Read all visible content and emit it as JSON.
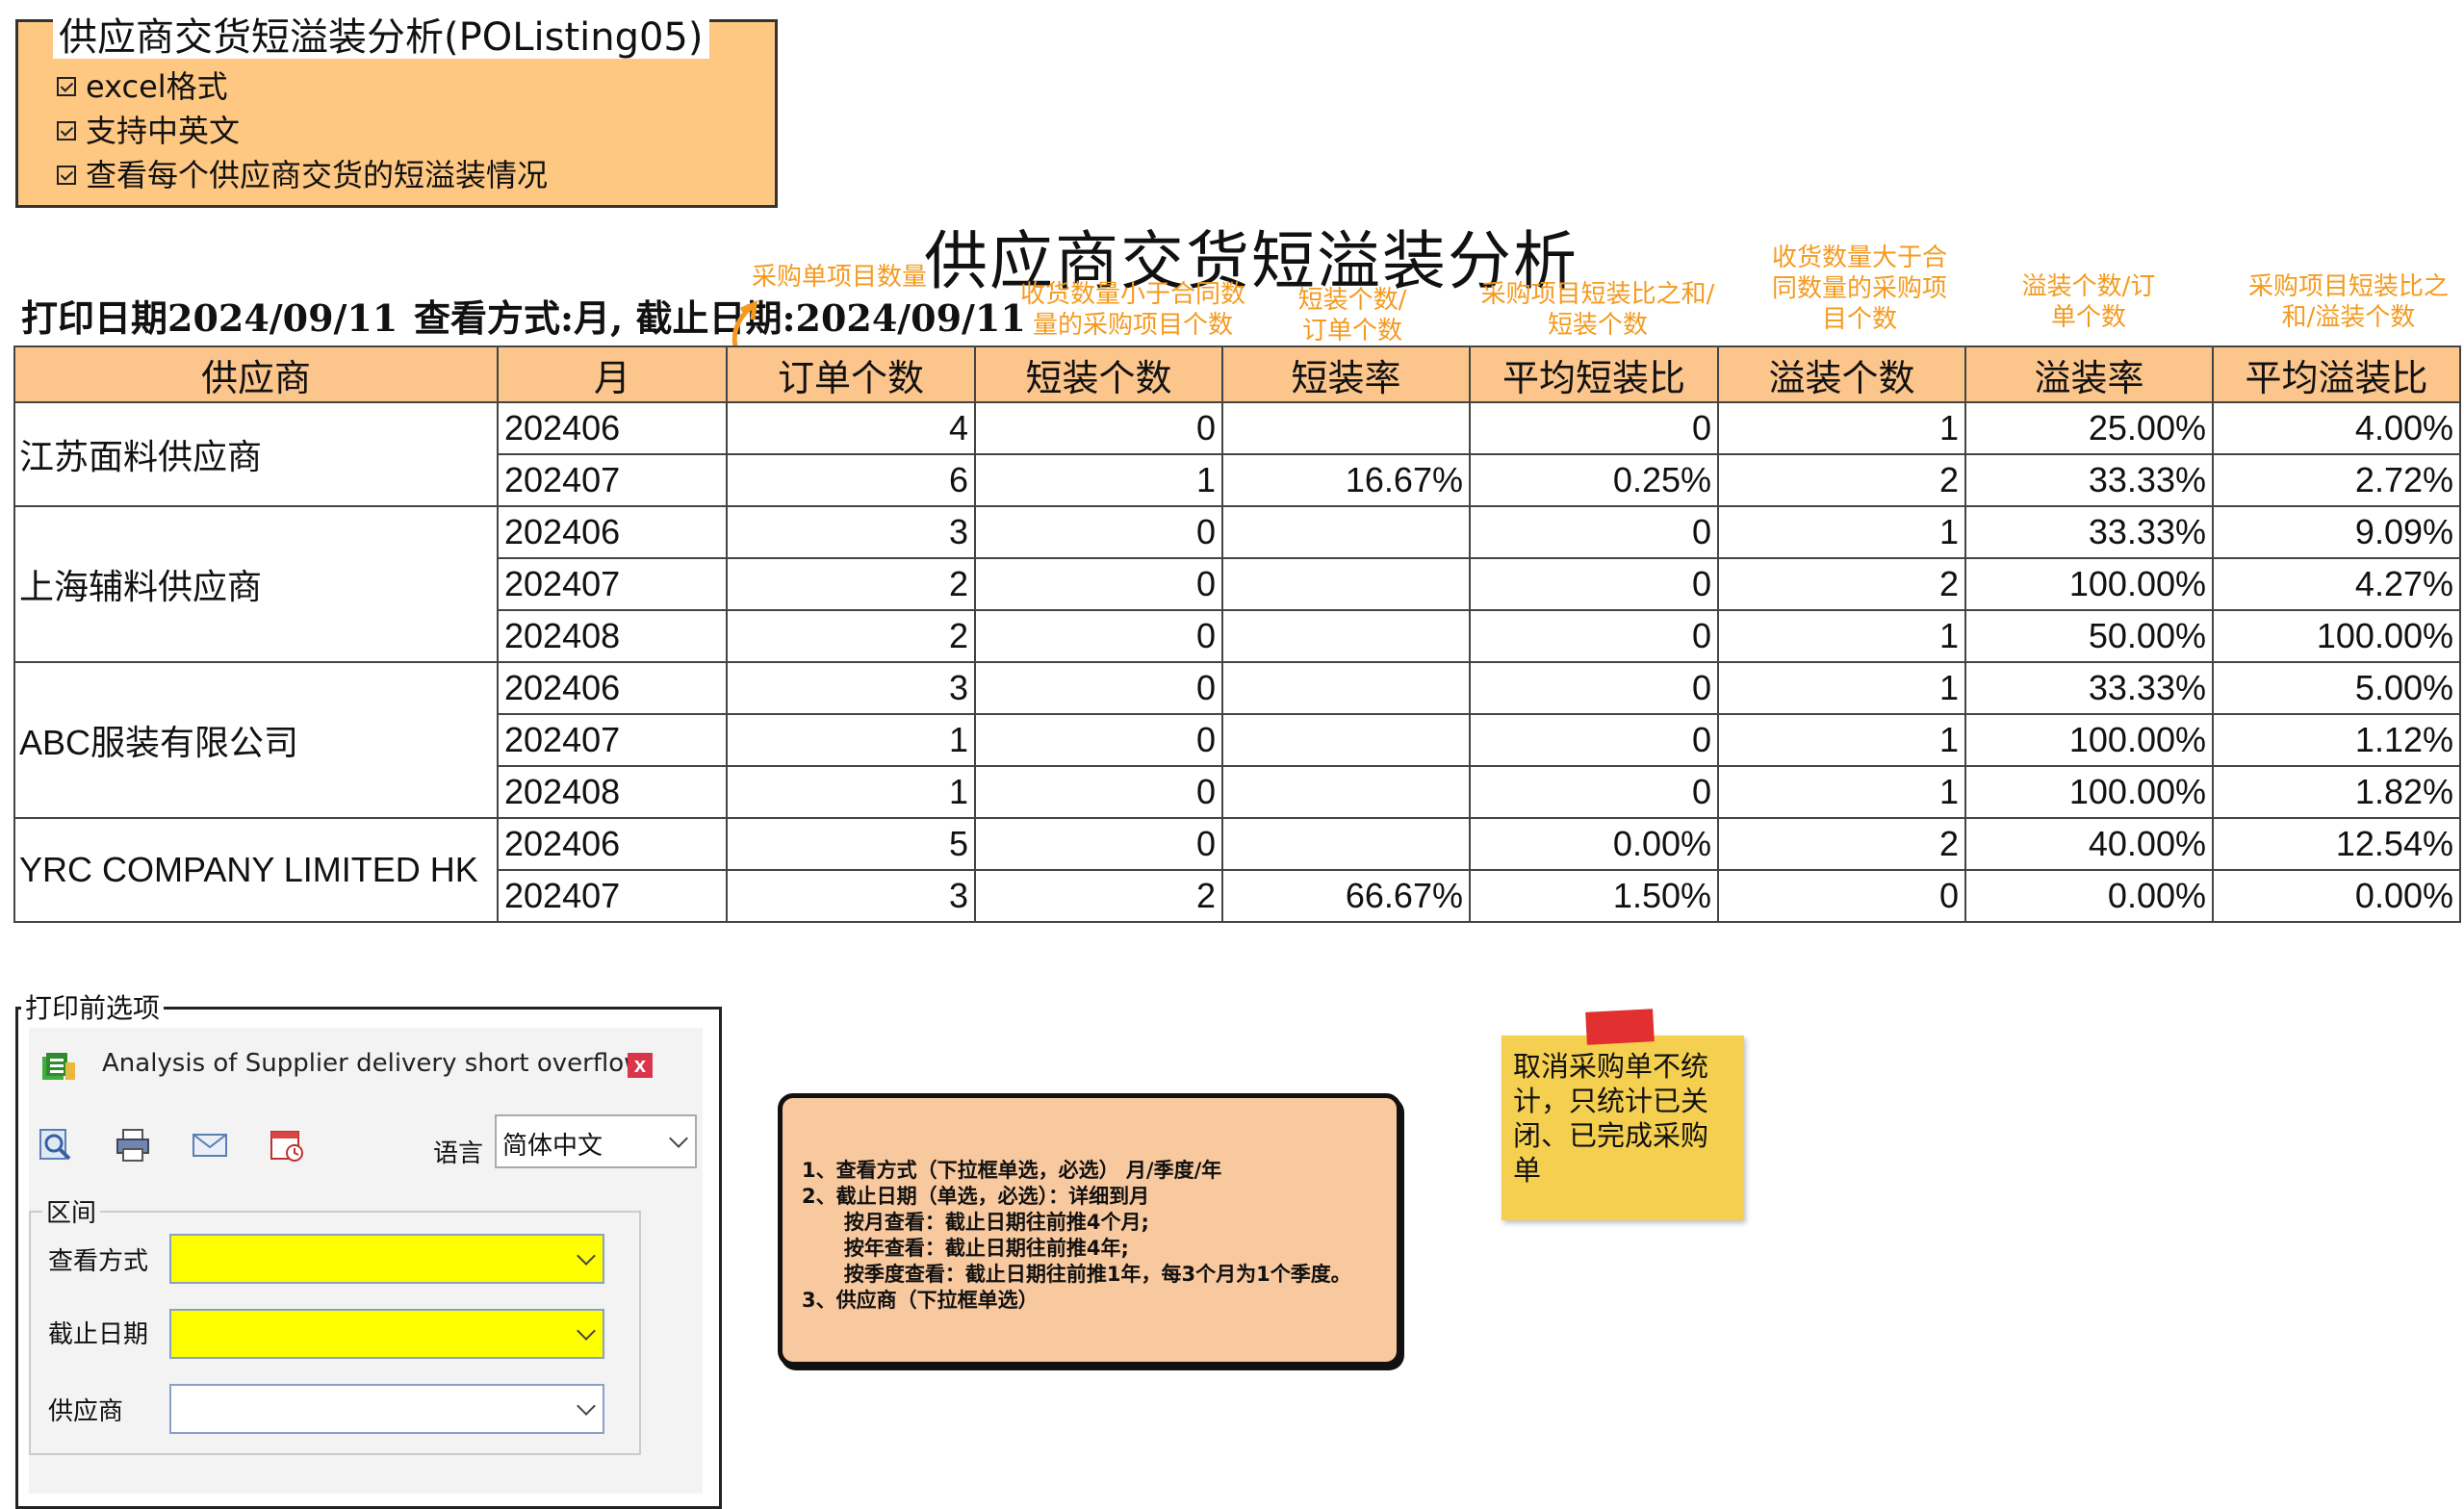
{
  "feature": {
    "title": "供应商交货短溢装分析(POListing05)",
    "items": [
      "excel格式",
      "支持中英文",
      "查看每个供应商交货的短溢装情况"
    ]
  },
  "report": {
    "title": "供应商交货短溢装分析",
    "print_date": "打印日期2024/09/11",
    "view_mode": "查看方式:月, 截止日期:2024/09/11"
  },
  "annotations": {
    "order_count": "采购单项目数量",
    "short_count": "收货数量小于合同数量的采购项目个数",
    "short_rate": "短装个数/订单个数",
    "avg_short": "采购项目短装比之和/短装个数",
    "over_count": "收货数量大于合同数量的采购项目个数",
    "over_rate": "溢装个数/订单个数",
    "avg_over": "采购项目短装比之和/溢装个数"
  },
  "table": {
    "headers": [
      "供应商",
      "月",
      "订单个数",
      "短装个数",
      "短装率",
      "平均短装比",
      "溢装个数",
      "溢装率",
      "平均溢装比"
    ],
    "groups": [
      {
        "supplier": "江苏面料供应商",
        "rows": [
          [
            "202406",
            "4",
            "0",
            "",
            "0",
            "1",
            "25.00%",
            "4.00%"
          ],
          [
            "202407",
            "6",
            "1",
            "16.67%",
            "0.25%",
            "2",
            "33.33%",
            "2.72%"
          ]
        ]
      },
      {
        "supplier": "上海辅料供应商",
        "rows": [
          [
            "202406",
            "3",
            "0",
            "",
            "0",
            "1",
            "33.33%",
            "9.09%"
          ],
          [
            "202407",
            "2",
            "0",
            "",
            "0",
            "2",
            "100.00%",
            "4.27%"
          ],
          [
            "202408",
            "2",
            "0",
            "",
            "0",
            "1",
            "50.00%",
            "100.00%"
          ]
        ]
      },
      {
        "supplier": "ABC服装有限公司",
        "rows": [
          [
            "202406",
            "3",
            "0",
            "",
            "0",
            "1",
            "33.33%",
            "5.00%"
          ],
          [
            "202407",
            "1",
            "0",
            "",
            "0",
            "1",
            "100.00%",
            "1.12%"
          ],
          [
            "202408",
            "1",
            "0",
            "",
            "0",
            "1",
            "100.00%",
            "1.82%"
          ]
        ]
      },
      {
        "supplier": "YRC COMPANY LIMITED HK",
        "rows": [
          [
            "202406",
            "5",
            "0",
            "",
            "0.00%",
            "2",
            "40.00%",
            "12.54%"
          ],
          [
            "202407",
            "3",
            "2",
            "66.67%",
            "1.50%",
            "0",
            "0.00%",
            "0.00%"
          ]
        ]
      }
    ]
  },
  "options": {
    "legend": "打印前选项",
    "dialog_title": "Analysis of Supplier delivery short overflow",
    "close": "x",
    "lang_label": "语言",
    "lang_value": "简体中文",
    "range_legend": "区间",
    "fields": [
      "查看方式",
      "截止日期",
      "供应商"
    ]
  },
  "notes": {
    "text": "1、查看方式（下拉框单选，必选） 月/季度/年\n2、截止日期（单选，必选）：详细到月\n      按月查看：截止日期往前推4个月;\n      按年查看：截止日期往前推4年;\n      按季度查看：截止日期往前推1年，每3个月为1个季度。\n3、供应商（下拉框单选）"
  },
  "sticky": {
    "text": "取消采购单不统计，只统计已关闭、已完成采购单"
  },
  "colors": {
    "feature_bg": "#ffc882",
    "header_bg": "#fbc58c",
    "annotation": "#f59a1f",
    "required_field": "#ffff00",
    "notes_bg": "#f8c89e",
    "sticky_bg": "#f5cf4f"
  }
}
